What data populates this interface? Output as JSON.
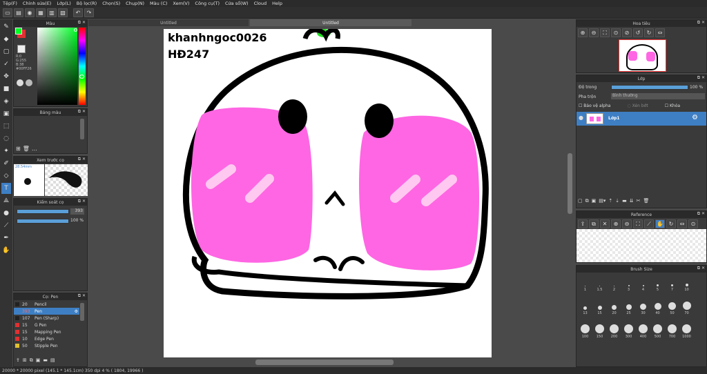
{
  "menu": [
    "Tệp(F)",
    "Chỉnh sửa(E)",
    "Lớp(L)",
    "Bộ lọc(R)",
    "Chọn(S)",
    "Chụp(N)",
    "Màu (C)",
    "Xem(V)",
    "Công cụ(T)",
    "Cửa sổ(W)",
    "Cloud",
    "Help"
  ],
  "doc_tabs": [
    "Untitled",
    "Untitled"
  ],
  "color_panel": {
    "title": "Màu",
    "r": "R:0",
    "g": "G:255",
    "b": "B:38",
    "hex": "#00FF26",
    "fg": "#00ff26",
    "bg": "#e03030"
  },
  "palette_title": "Bảng màu",
  "brush_preview": {
    "title": "Xem trước cọ",
    "size": "28.54mm"
  },
  "brush_control": {
    "title": "Kiểm soát cọ",
    "size_val": "393",
    "opacity_val": "100 %"
  },
  "brush_list": {
    "title": "Cọ: Pen",
    "items": [
      {
        "size": "20",
        "name": "Pencil",
        "color": "#222"
      },
      {
        "size": "393",
        "name": "Pen",
        "color": "#3e7fc4",
        "selected": true
      },
      {
        "size": "107",
        "name": "Pen (Sharp)",
        "color": "#222"
      },
      {
        "size": "15",
        "name": "G Pen",
        "color": "#e03030"
      },
      {
        "size": "15",
        "name": "Mapping Pen",
        "color": "#e03030"
      },
      {
        "size": "10",
        "name": "Edge Pen",
        "color": "#e03030"
      },
      {
        "size": "50",
        "name": "Stipple Pen",
        "color": "#e0c030"
      }
    ]
  },
  "canvas_text": {
    "line1": "khanhngoc0026",
    "line2": "HĐ247"
  },
  "navigator_title": "Hoa tiêu",
  "layers": {
    "title": "Lớp",
    "opacity_label": "Độ trong",
    "opacity_val": "100 %",
    "blend_label": "Pha trộn",
    "blend_val": "Bình thường",
    "protect_alpha": "Bảo vệ alpha",
    "clip": "Xén bớt",
    "lock": "Khóa",
    "layer_name": "Lớp1"
  },
  "reference_title": "Reference",
  "brush_size": {
    "title": "Brush Size",
    "row1": [
      "1",
      "1.5",
      "2",
      "3",
      "4",
      "5",
      "7",
      "10"
    ],
    "row2": [
      "13",
      "15",
      "20",
      "25",
      "30",
      "40",
      "50",
      "70"
    ],
    "row3": [
      "100",
      "150",
      "200",
      "300",
      "400",
      "500",
      "700",
      "1000"
    ]
  },
  "status": "20000 * 20000 pixel  (145.1 * 145.1cm)  350 dpi  4 %  ( 1804, 19966 )",
  "colors": {
    "accent": "#3e7fc4",
    "blush": "#ff66e3",
    "blush_highlight": "#ffc8f0",
    "leaf": "#22dd22"
  }
}
